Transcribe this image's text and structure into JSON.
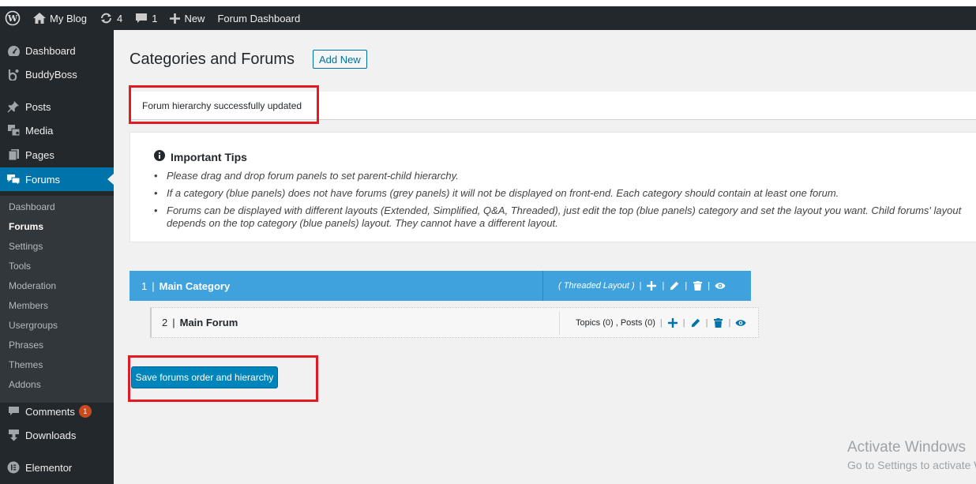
{
  "adminbar": {
    "site_name": "My Blog",
    "updates_count": "4",
    "comments_count": "1",
    "new_label": "New",
    "forum_dashboard_label": "Forum Dashboard"
  },
  "sidebar": {
    "items": [
      {
        "label": "Dashboard",
        "icon": "dashboard-icon"
      },
      {
        "label": "BuddyBoss",
        "icon": "buddyboss-icon"
      },
      {
        "label": "Posts",
        "icon": "pin-icon"
      },
      {
        "label": "Media",
        "icon": "media-icon"
      },
      {
        "label": "Pages",
        "icon": "pages-icon"
      },
      {
        "label": "Forums",
        "icon": "forums-icon"
      },
      {
        "label": "Comments",
        "icon": "comment-icon",
        "badge": "1"
      },
      {
        "label": "Downloads",
        "icon": "download-icon"
      },
      {
        "label": "Elementor",
        "icon": "elementor-icon"
      }
    ],
    "submenu": [
      "Dashboard",
      "Forums",
      "Settings",
      "Tools",
      "Moderation",
      "Members",
      "Usergroups",
      "Phrases",
      "Themes",
      "Addons"
    ]
  },
  "page": {
    "title": "Categories and Forums",
    "add_new_label": "Add New",
    "notice": "Forum hierarchy successfully updated"
  },
  "tips": {
    "heading": "Important Tips",
    "items": [
      "Please drag and drop forum panels to set parent-child hierarchy.",
      "If a category (blue panels) does not have forums (grey panels) it will not be displayed on front-end. Each category should contain at least one forum.",
      "Forums can be displayed with different layouts (Extended, Simplified, Q&A, Threaded), just edit the top (blue panels) category and set the layout you want. Child forums' layout depends on the top category (blue panels) layout. They cannot have a different layout."
    ]
  },
  "category": {
    "number": "1",
    "title": "Main Category",
    "layout": "( Threaded Layout )"
  },
  "forum": {
    "number": "2",
    "title": "Main Forum",
    "stats": "Topics (0) , Posts (0)"
  },
  "save_button_label": "Save forums order and hierarchy",
  "watermark": {
    "line1": "Activate Windows",
    "line2": "Go to Settings to activate Windows."
  },
  "colors": {
    "adminbar_bg": "#23282d",
    "accent": "#0073aa",
    "category_blue": "#40a2dc",
    "highlight_red": "#e01b24",
    "save_button": "#0085ba"
  }
}
